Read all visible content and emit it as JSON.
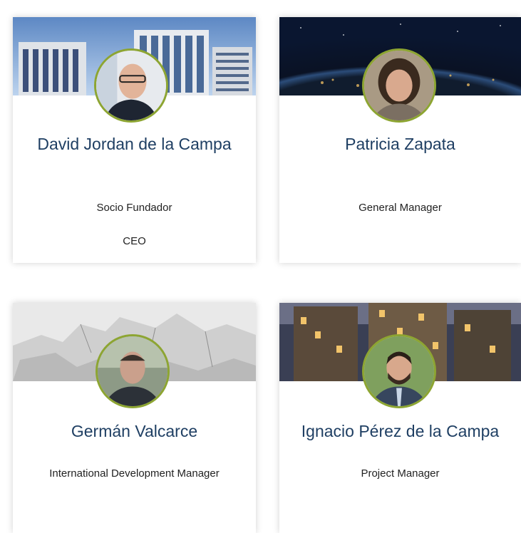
{
  "team": [
    {
      "name": "David Jordan de la Campa",
      "roles": [
        "Socio Fundador",
        "CEO"
      ],
      "banner": "office-buildings-banner",
      "accent": "#8da532"
    },
    {
      "name": "Patricia Zapata",
      "roles": [
        "General Manager"
      ],
      "banner": "earth-night-banner",
      "accent": "#8da532"
    },
    {
      "name": "Germán Valcarce",
      "roles": [
        "International Development Manager"
      ],
      "banner": "world-map-banner",
      "accent": "#8da532"
    },
    {
      "name": "Ignacio Pérez de la Campa",
      "roles": [
        "Project Manager"
      ],
      "banner": "city-skyline-banner",
      "accent": "#8da532"
    }
  ],
  "colors": {
    "name_text": "#1f3f63",
    "role_text": "#222222",
    "avatar_border": "#8da532"
  }
}
